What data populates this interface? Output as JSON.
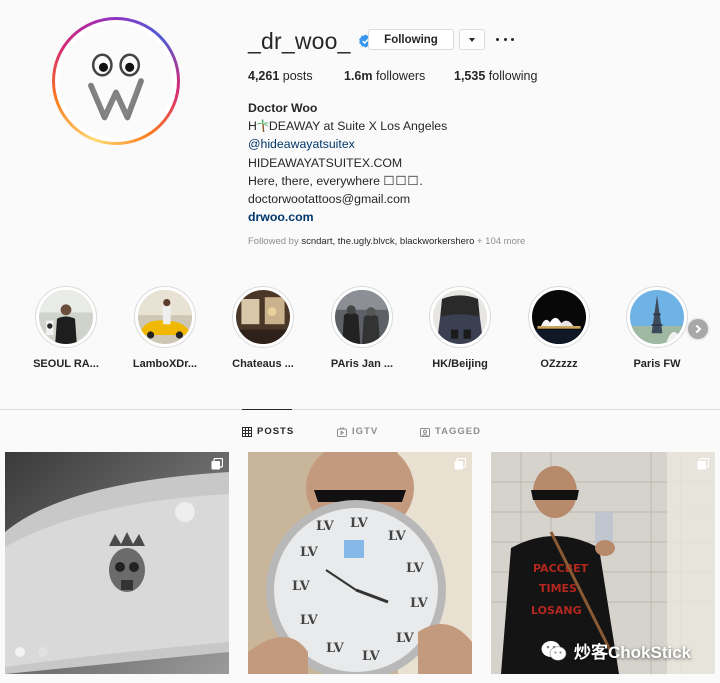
{
  "profile": {
    "username": "_dr_woo_",
    "following_button": "Following",
    "stats": {
      "posts_count": "4,261",
      "posts_label": "posts",
      "followers_count": "1.6m",
      "followers_label": "followers",
      "following_count": "1,535",
      "following_label": "following"
    },
    "bio": {
      "full_name": "Doctor Woo",
      "line1_prefix": "H",
      "line1_suffix": "DEAWAY at Suite X Los Angeles",
      "mention": "@hideawayatsuitex",
      "line3": "HIDEAWAYATSUITEX.COM",
      "line4_text": "Here, there, everywhere",
      "line4_boxes": "☐☐☐.",
      "email": "doctorwootattoos@gmail.com",
      "website": "drwoo.com"
    },
    "followed_by_prefix": "Followed by",
    "followed_by_names": "scndart, the.ugly.blvck, blackworkershero",
    "followed_by_more": "+ 104 more"
  },
  "highlights": [
    {
      "label": "SEOUL RA..."
    },
    {
      "label": "LamboXDr..."
    },
    {
      "label": "Chateaus ..."
    },
    {
      "label": "PAris Jan ..."
    },
    {
      "label": "HK/Beijing"
    },
    {
      "label": "OZzzzz"
    },
    {
      "label": "Paris FW"
    }
  ],
  "tabs": [
    {
      "label": "POSTS",
      "icon": "grid-icon",
      "active": true
    },
    {
      "label": "IGTV",
      "icon": "igtv-icon",
      "active": false
    },
    {
      "label": "TAGGED",
      "icon": "tagged-icon",
      "active": false
    }
  ],
  "watermark": "炒客ChokStick",
  "colors": {
    "link": "#00376b",
    "verified": "#3897f0",
    "muted": "#8e8e8e",
    "text": "#262626"
  }
}
